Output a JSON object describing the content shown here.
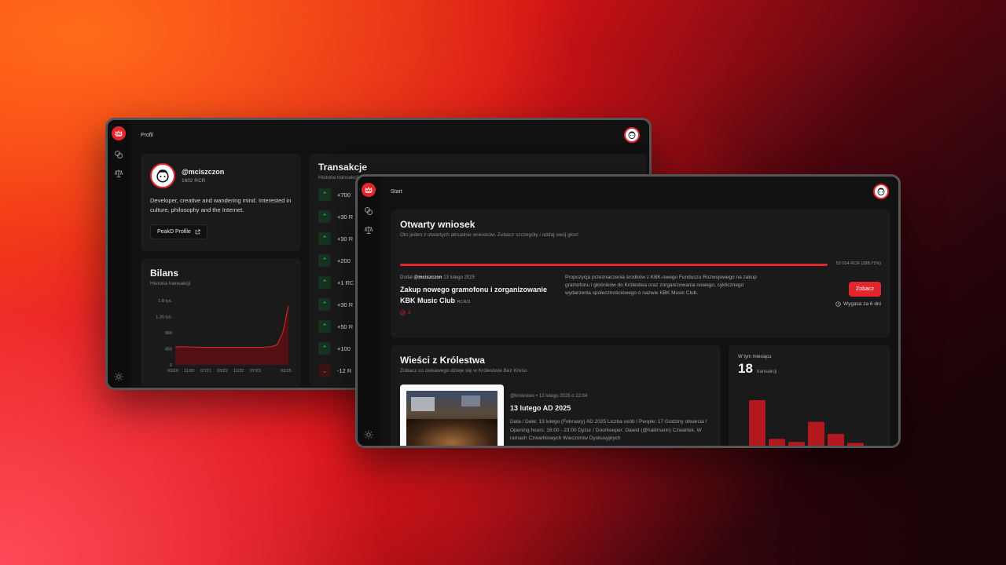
{
  "profile_window": {
    "title": "Profil",
    "profile": {
      "handle": "@mciszczon",
      "balance": "1602 RCR",
      "bio": "Developer, creative and wandering mind. Interested in culture, philosophy and the Internet.",
      "link_label": "PeakD Profile"
    },
    "bilans": {
      "title": "Bilans",
      "subtitle": "Historia transakcji"
    },
    "transactions": {
      "title": "Transakcje",
      "subtitle": "Historia transakcji",
      "items": [
        {
          "amount": "+700",
          "dir": "up"
        },
        {
          "amount": "+30 R",
          "dir": "up"
        },
        {
          "amount": "+30 R",
          "dir": "up"
        },
        {
          "amount": "+200",
          "dir": "up"
        },
        {
          "amount": "+1 RC",
          "dir": "up"
        },
        {
          "amount": "+30 R",
          "dir": "up"
        },
        {
          "amount": "+50 R",
          "dir": "up"
        },
        {
          "amount": "+100",
          "dir": "up"
        },
        {
          "amount": "-12 R",
          "dir": "down"
        }
      ]
    }
  },
  "start_window": {
    "title": "Start",
    "proposal": {
      "section_title": "Otwarty wniosek",
      "section_subtitle": "Oto jeden z otwartych aktualnie wniosków. Zobacz szczegóły i oddaj swój głos!",
      "progress": 1.0,
      "progress_label": "52 014 RCR (288,71%)",
      "meta_prefix": "Dodał",
      "author": "@mciszczon",
      "date": "13 lutego 2025",
      "title": "Zakup nowego gramofonu i zorganizowanie KBK Music Club",
      "tag": "RCR/3",
      "votes": "3",
      "description": "Propozycja przeznaczenia środków z KBK-owego Funduszu Rozwojowego na zakup gramofonu i głośników do Królestwa oraz zorganizowania nowego, cyklicznego wydarzenia społecznościowego o nazwie KBK Music Club.",
      "button": "Zobacz",
      "expires": "Wygasa za 6 dni"
    },
    "news": {
      "section_title": "Wieści z Królestwa",
      "section_subtitle": "Zobacz co ciekawego dzieje się w Królestwie Bez Kresu",
      "meta": "@krolestwo • 13 lutego 2025 o 22:04",
      "title": "13 lutego AD 2025",
      "body": "Data / Date: 13 lutego (February) AD 2025 Liczba osób / People: 17 Godziny otwarcia / Opening hours: 16:00 - 23:00 Dyżur / Doorkeeper: Dawid (@haliimann) Czwartek. W ramach Czwartkowych Wieczorów Dyskusyjnych"
    },
    "stats": {
      "label": "W tym miesiącu",
      "value": "18",
      "unit": "transakcji"
    }
  },
  "chart_data": [
    {
      "type": "area",
      "title": "Bilans",
      "subtitle": "Historia transakcji",
      "x_ticks": [
        "03/20",
        "11/20",
        "07/21",
        "03/22",
        "11/22",
        "07/23",
        "02/25"
      ],
      "y_ticks": [
        "0",
        "450",
        "900",
        "1,35 tys.",
        "1,8 tys."
      ],
      "ylim": [
        0,
        1800
      ],
      "x": [
        0,
        1,
        2,
        3,
        4,
        5,
        6,
        7,
        8,
        9,
        10,
        11,
        12,
        13,
        14,
        15,
        16,
        17,
        18,
        19,
        20
      ],
      "y": [
        500,
        510,
        505,
        500,
        498,
        495,
        495,
        495,
        495,
        495,
        495,
        495,
        495,
        495,
        495,
        495,
        500,
        510,
        560,
        900,
        1650
      ],
      "color": "#e3262e"
    },
    {
      "type": "bar",
      "title": "",
      "values": [
        100,
        23,
        17,
        57,
        33,
        15
      ],
      "color": "#b3181f"
    }
  ]
}
